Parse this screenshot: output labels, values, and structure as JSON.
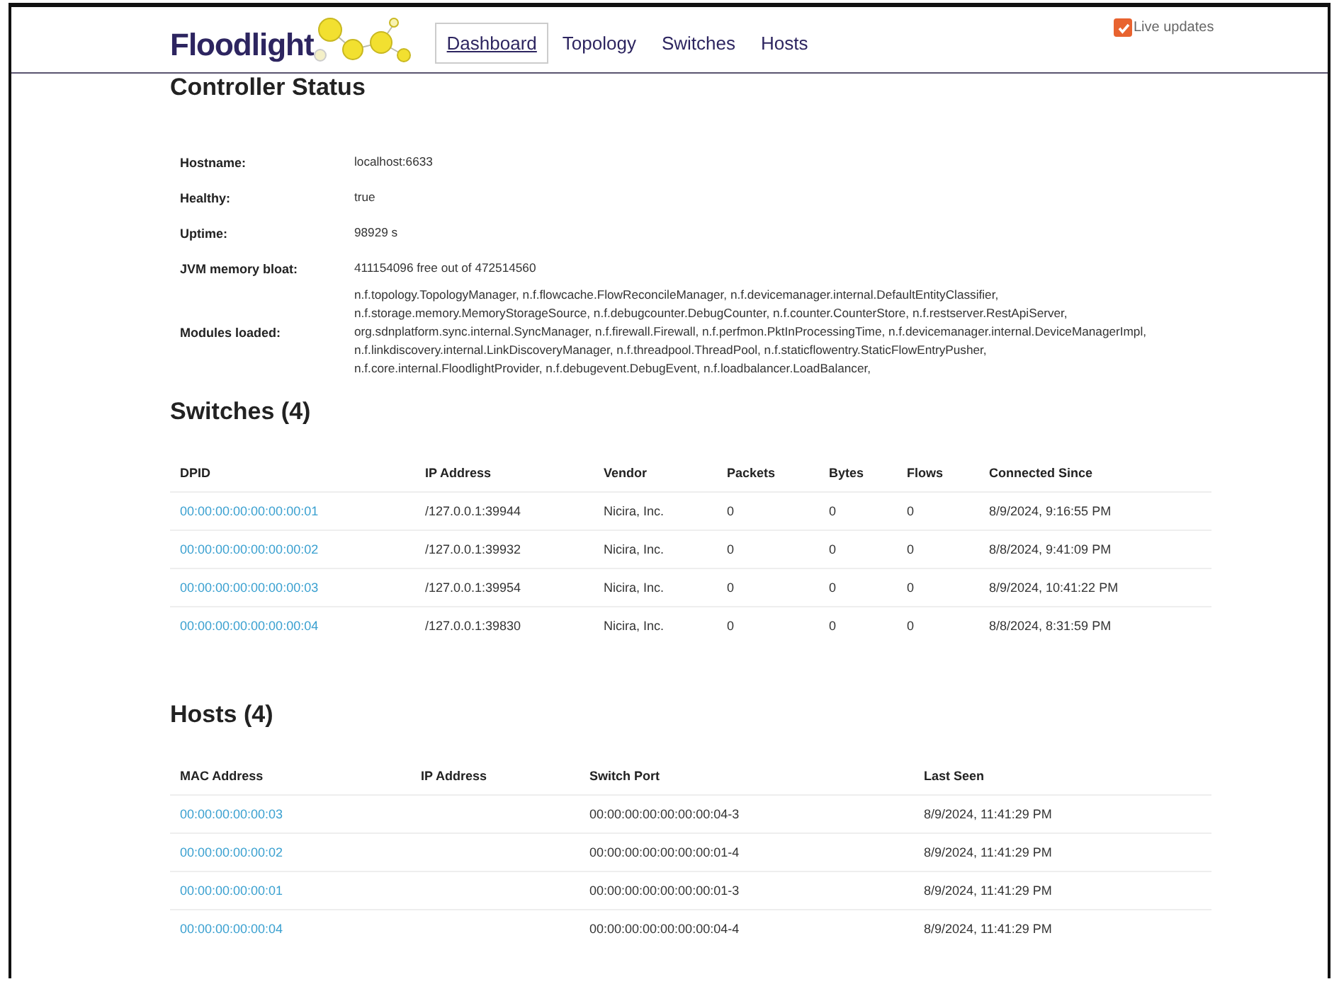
{
  "header": {
    "logo": "Floodlight",
    "nav": [
      {
        "label": "Dashboard",
        "selected": true
      },
      {
        "label": "Topology",
        "selected": false
      },
      {
        "label": "Switches",
        "selected": false
      },
      {
        "label": "Hosts",
        "selected": false
      }
    ],
    "live_updates": {
      "label": "Live updates",
      "checked": true
    }
  },
  "controller": {
    "title": "Controller Status",
    "rows": [
      {
        "label": "Hostname:",
        "value": "localhost:6633"
      },
      {
        "label": "Healthy:",
        "value": "true"
      },
      {
        "label": "Uptime:",
        "value": "98929 s"
      },
      {
        "label": "JVM memory bloat:",
        "value": "411154096 free out of 472514560"
      },
      {
        "label": "Modules loaded:",
        "value": "n.f.topology.TopologyManager, n.f.flowcache.FlowReconcileManager, n.f.devicemanager.internal.DefaultEntityClassifier, n.f.storage.memory.MemoryStorageSource, n.f.debugcounter.DebugCounter, n.f.counter.CounterStore, n.f.restserver.RestApiServer, org.sdnplatform.sync.internal.SyncManager, n.f.firewall.Firewall, n.f.perfmon.PktInProcessingTime, n.f.devicemanager.internal.DeviceManagerImpl, n.f.linkdiscovery.internal.LinkDiscoveryManager, n.f.threadpool.ThreadPool, n.f.staticflowentry.StaticFlowEntryPusher, n.f.core.internal.FloodlightProvider, n.f.debugevent.DebugEvent, n.f.loadbalancer.LoadBalancer,"
      }
    ]
  },
  "switches": {
    "title": "Switches (4)",
    "columns": [
      "DPID",
      "IP Address",
      "Vendor",
      "Packets",
      "Bytes",
      "Flows",
      "Connected Since"
    ],
    "rows": [
      [
        "00:00:00:00:00:00:00:01",
        "/127.0.0.1:39944",
        "Nicira, Inc.",
        "0",
        "0",
        "0",
        "8/9/2024, 9:16:55 PM"
      ],
      [
        "00:00:00:00:00:00:00:02",
        "/127.0.0.1:39932",
        "Nicira, Inc.",
        "0",
        "0",
        "0",
        "8/8/2024, 9:41:09 PM"
      ],
      [
        "00:00:00:00:00:00:00:03",
        "/127.0.0.1:39954",
        "Nicira, Inc.",
        "0",
        "0",
        "0",
        "8/9/2024, 10:41:22 PM"
      ],
      [
        "00:00:00:00:00:00:00:04",
        "/127.0.0.1:39830",
        "Nicira, Inc.",
        "0",
        "0",
        "0",
        "8/8/2024, 8:31:59 PM"
      ]
    ]
  },
  "hosts": {
    "title": "Hosts (4)",
    "columns": [
      "MAC Address",
      "IP Address",
      "Switch Port",
      "Last Seen"
    ],
    "rows": [
      [
        "00:00:00:00:00:03",
        "",
        "00:00:00:00:00:00:00:04-3",
        "8/9/2024, 11:41:29 PM"
      ],
      [
        "00:00:00:00:00:02",
        "",
        "00:00:00:00:00:00:00:01-4",
        "8/9/2024, 11:41:29 PM"
      ],
      [
        "00:00:00:00:00:01",
        "",
        "00:00:00:00:00:00:00:01-3",
        "8/9/2024, 11:41:29 PM"
      ],
      [
        "00:00:00:00:00:04",
        "",
        "00:00:00:00:00:00:00:04-4",
        "8/9/2024, 11:41:29 PM"
      ]
    ]
  }
}
